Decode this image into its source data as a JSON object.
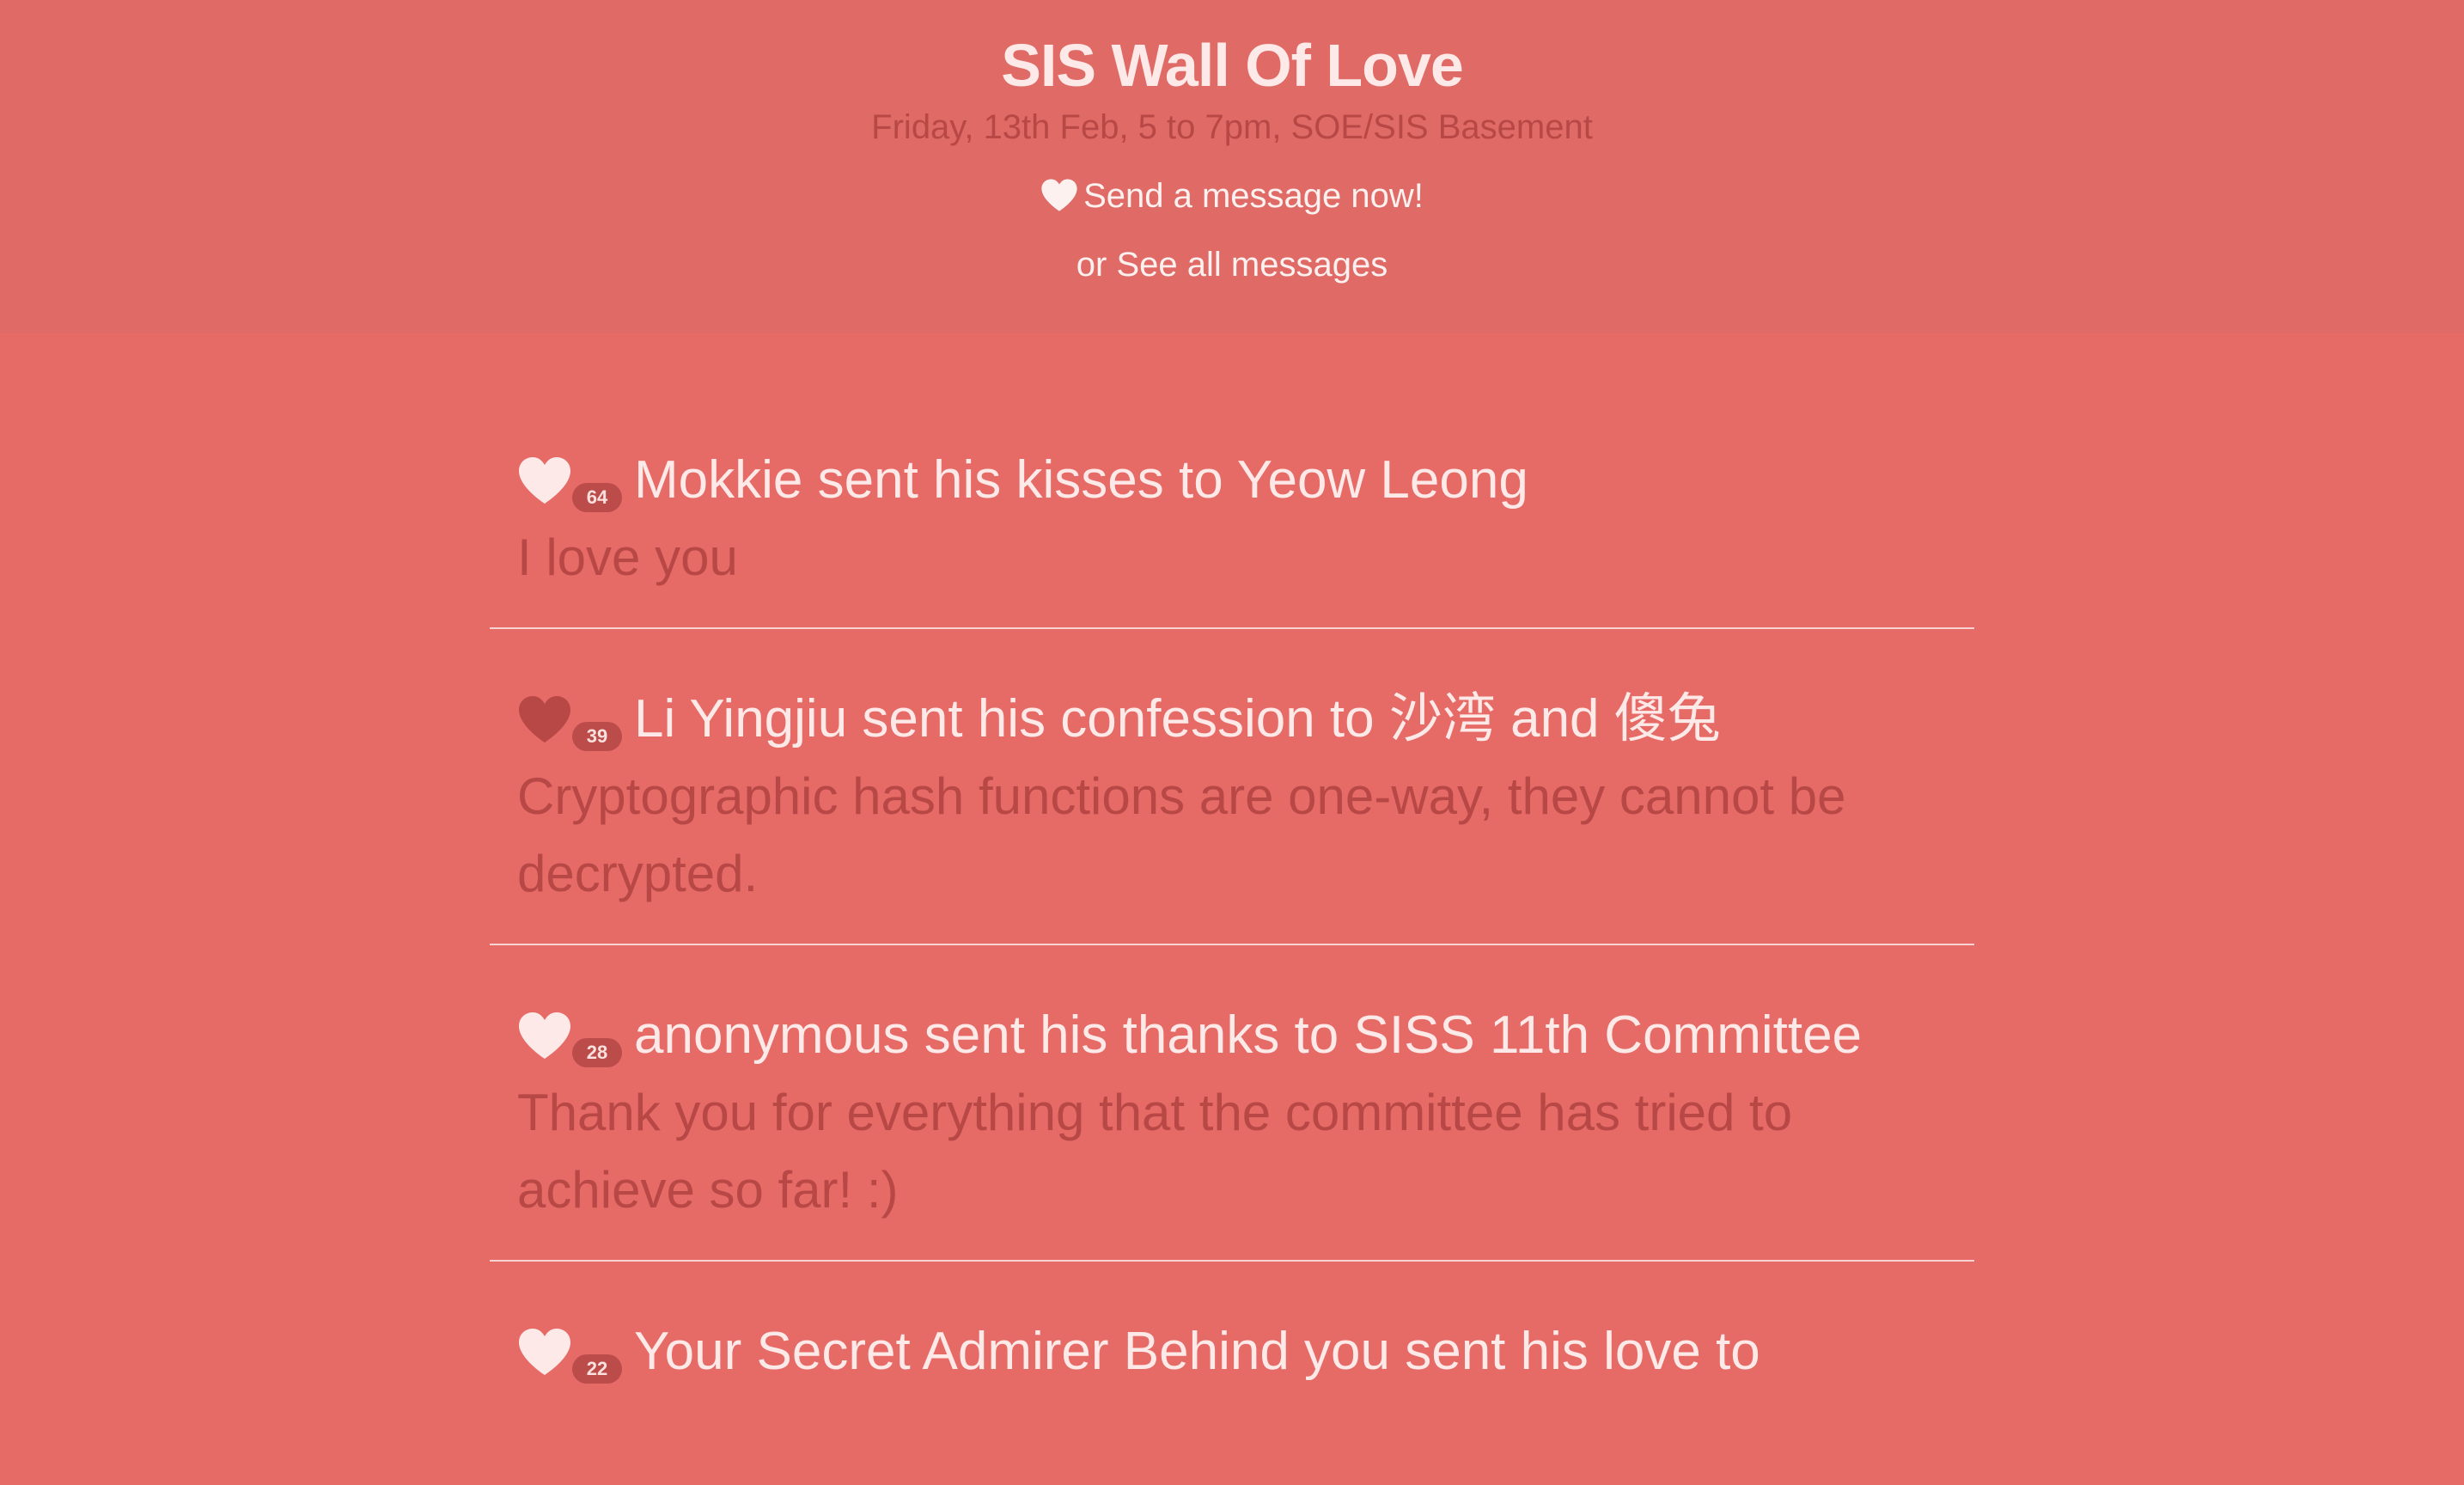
{
  "header": {
    "title": "SIS Wall Of Love",
    "subtitle": "Friday, 13th Feb, 5 to 7pm, SOE/SIS Basement",
    "send_link": "Send a message now!",
    "see_all": "or See all messages"
  },
  "messages": [
    {
      "likes": "64",
      "heart_state": "unliked",
      "title": "Mokkie sent his kisses to Yeow Leong",
      "body": "I love you"
    },
    {
      "likes": "39",
      "heart_state": "liked",
      "title": "Li Yingjiu sent his confession to 沙湾 and 傻兔",
      "body": "Cryptographic hash functions are one-way, they cannot be decrypted."
    },
    {
      "likes": "28",
      "heart_state": "unliked",
      "title": "anonymous sent his thanks to SISS 11th Committee",
      "body": "Thank you for everything that the committee has tried to achieve so far! :)"
    },
    {
      "likes": "22",
      "heart_state": "unliked",
      "title": "Your Secret Admirer Behind you sent his love to",
      "body": ""
    }
  ],
  "colors": {
    "background": "#e66a66",
    "header_background": "#df6a66",
    "heart_unliked": "#fde9e7",
    "heart_liked": "#b84846",
    "badge": "#bb4c4a",
    "body_text": "#b84846"
  }
}
